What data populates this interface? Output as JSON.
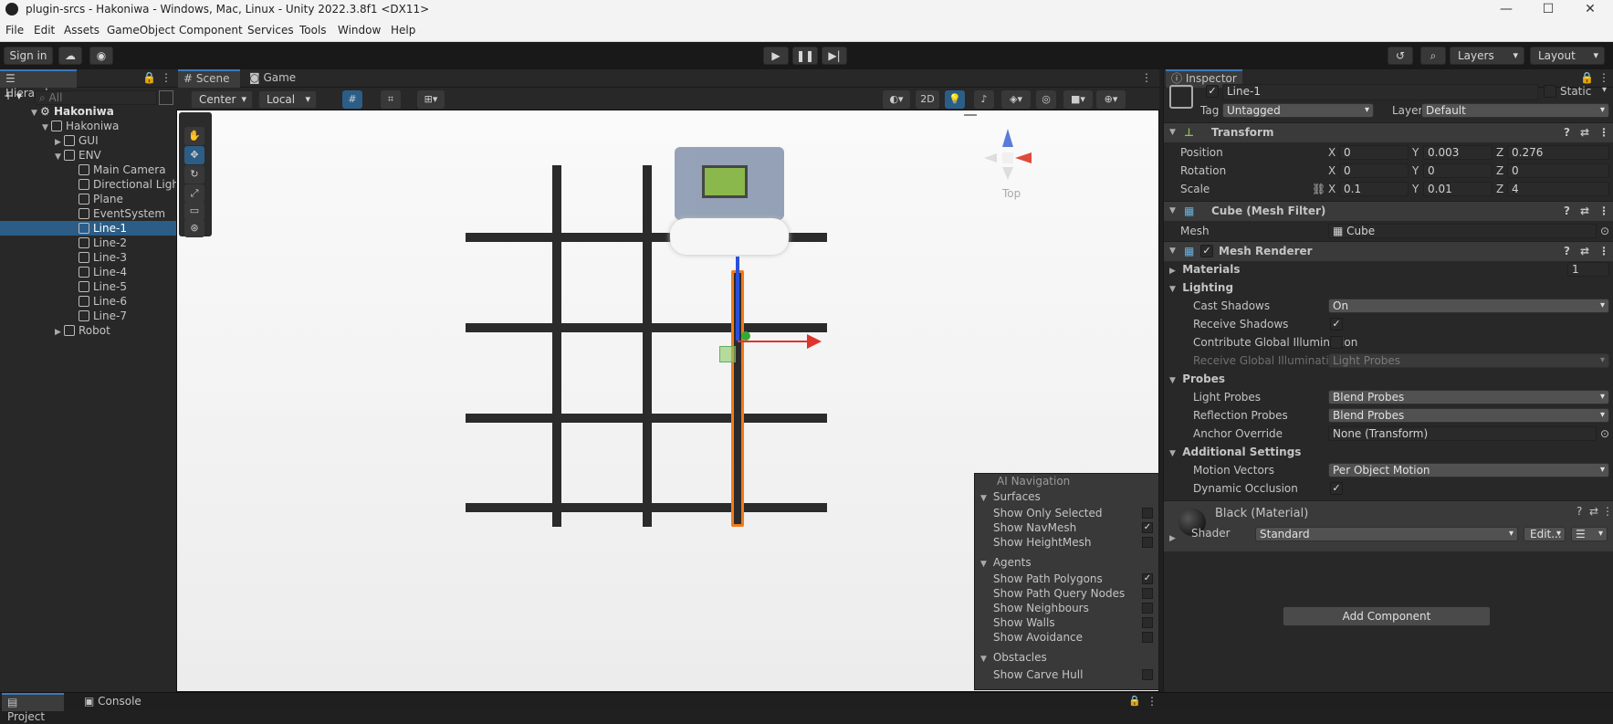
{
  "window": {
    "title": "plugin-srcs - Hakoniwa - Windows, Mac, Linux - Unity 2022.3.8f1 <DX11>"
  },
  "menu": [
    "File",
    "Edit",
    "Assets",
    "GameObject",
    "Component",
    "Services",
    "Tools",
    "Window",
    "Help"
  ],
  "toolbar": {
    "signin": "Sign in",
    "layers": "Layers",
    "layout": "Layout"
  },
  "hierarchy": {
    "tab": "Hierarchy",
    "search_placeholder": "All",
    "items": [
      "Hakoniwa",
      "Hakoniwa",
      "GUI",
      "ENV",
      "Main Camera",
      "Directional Ligh",
      "Plane",
      "EventSystem",
      "Line-1",
      "Line-2",
      "Line-3",
      "Line-4",
      "Line-5",
      "Line-6",
      "Line-7",
      "Robot"
    ],
    "selected": "Line-1"
  },
  "scene": {
    "tabs": [
      "Scene",
      "Game"
    ],
    "pivot": "Center",
    "space": "Local",
    "mode2d": "2D",
    "gizmo_label": "Top"
  },
  "ai_navigation": {
    "title": "AI Navigation",
    "surfaces": {
      "label": "Surfaces",
      "items": [
        {
          "label": "Show Only Selected",
          "checked": false
        },
        {
          "label": "Show NavMesh",
          "checked": true
        },
        {
          "label": "Show HeightMesh",
          "checked": false
        }
      ]
    },
    "agents": {
      "label": "Agents",
      "items": [
        {
          "label": "Show Path Polygons",
          "checked": true
        },
        {
          "label": "Show Path Query Nodes",
          "checked": false
        },
        {
          "label": "Show Neighbours",
          "checked": false
        },
        {
          "label": "Show Walls",
          "checked": false
        },
        {
          "label": "Show Avoidance",
          "checked": false
        }
      ]
    },
    "obstacles": {
      "label": "Obstacles",
      "items": [
        {
          "label": "Show Carve Hull",
          "checked": false
        }
      ]
    }
  },
  "inspector": {
    "tab": "Inspector",
    "object_name": "Line-1",
    "static_label": "Static",
    "tag_label": "Tag",
    "tag": "Untagged",
    "layer_label": "Layer",
    "layer": "Default",
    "transform": {
      "title": "Transform",
      "position": {
        "label": "Position",
        "x": "0",
        "y": "0.003",
        "z": "0.276"
      },
      "rotation": {
        "label": "Rotation",
        "x": "0",
        "y": "0",
        "z": "0"
      },
      "scale": {
        "label": "Scale",
        "x": "0.1",
        "y": "0.01",
        "z": "4"
      }
    },
    "mesh_filter": {
      "title": "Cube (Mesh Filter)",
      "mesh_label": "Mesh",
      "mesh": "Cube"
    },
    "mesh_renderer": {
      "title": "Mesh Renderer",
      "materials_label": "Materials",
      "materials_count": "1",
      "lighting_label": "Lighting",
      "cast_shadows_label": "Cast Shadows",
      "cast_shadows": "On",
      "receive_shadows_label": "Receive Shadows",
      "contribute_gi_label": "Contribute Global Illumination",
      "receive_gi_label": "Receive Global Illumination",
      "receive_gi": "Light Probes",
      "probes_label": "Probes",
      "light_probes_label": "Light Probes",
      "light_probes": "Blend Probes",
      "reflection_probes_label": "Reflection Probes",
      "reflection_probes": "Blend Probes",
      "anchor_override_label": "Anchor Override",
      "anchor_override": "None (Transform)",
      "additional_label": "Additional Settings",
      "motion_vectors_label": "Motion Vectors",
      "motion_vectors": "Per Object Motion",
      "dynamic_occlusion_label": "Dynamic Occlusion"
    },
    "material": {
      "title": "Black (Material)",
      "shader_label": "Shader",
      "shader": "Standard",
      "edit": "Edit..."
    },
    "add_component": "Add Component"
  },
  "bottom": {
    "tabs": [
      "Project",
      "Console"
    ]
  },
  "colors": {
    "selection": "#2c5d87",
    "accent": "#3a79bb",
    "orange": "#f27a1a"
  }
}
